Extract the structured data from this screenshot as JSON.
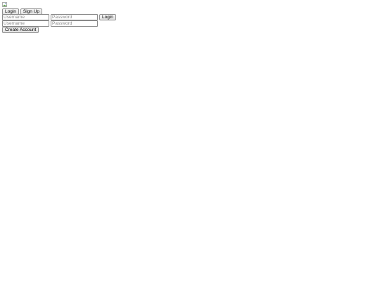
{
  "tabs": {
    "login_label": "Login",
    "signup_label": "Sign Up"
  },
  "login_form": {
    "username": {
      "value": "",
      "placeholder": "Username"
    },
    "password": {
      "value": "",
      "placeholder": "Password"
    },
    "submit_label": "Login"
  },
  "signup_form": {
    "username": {
      "value": "",
      "placeholder": "Username"
    },
    "password": {
      "value": "",
      "placeholder": "Password"
    },
    "submit_label": "Create Account"
  },
  "icons": {
    "broken_image": "broken-image-icon"
  },
  "colors": {
    "button_border": "#8f8f8f",
    "field_border": "#8a8a8a",
    "placeholder": "#8a8a8a",
    "background": "#ffffff"
  }
}
